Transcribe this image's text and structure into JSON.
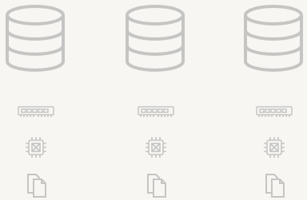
{
  "colors": {
    "background": "#f7f6f3",
    "icon_stroke": "#c5c5c4"
  },
  "servers": [
    {
      "icons": [
        "database-icon",
        "ram-module-icon",
        "cpu-chip-icon",
        "files-icon"
      ]
    },
    {
      "icons": [
        "database-icon",
        "ram-module-icon",
        "cpu-chip-icon",
        "files-icon"
      ]
    },
    {
      "icons": [
        "database-icon",
        "ram-module-icon",
        "cpu-chip-icon",
        "files-icon"
      ]
    }
  ]
}
